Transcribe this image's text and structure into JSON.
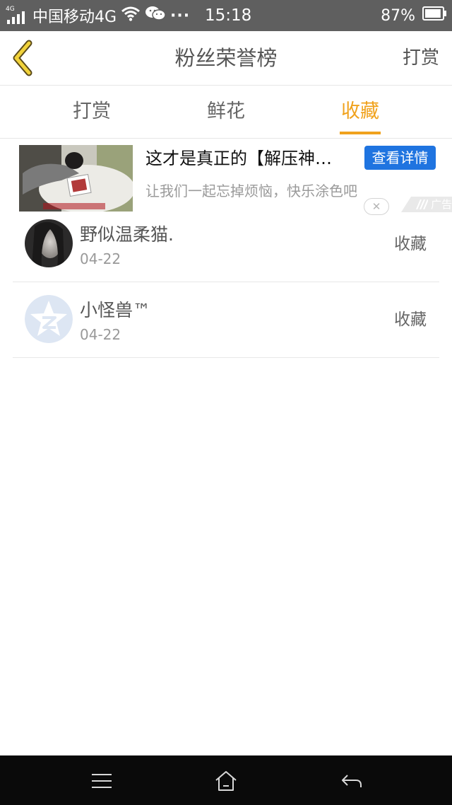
{
  "status_bar": {
    "network_type": "4G",
    "carrier": "中国移动4G",
    "more": "···",
    "time": "15:18",
    "battery": "87%",
    "battery_level": 0.87,
    "icons": [
      "signal-icon",
      "wifi-icon",
      "wechat-icon",
      "battery-icon"
    ]
  },
  "header": {
    "title": "粉丝荣誉榜",
    "action": "打赏",
    "back_icon": "chevron-left-icon"
  },
  "tabs": {
    "items": [
      {
        "label": "打赏"
      },
      {
        "label": "鲜花"
      },
      {
        "label": "收藏"
      }
    ],
    "active_index": 2,
    "active_color": "#f0a21d"
  },
  "ad": {
    "title": "这才是真正的【解压神…",
    "button": "查看详情",
    "description": "让我们一起忘掉烦恼，快乐涂色吧",
    "close_icon": "close-icon",
    "badge": "广告",
    "button_color": "#1f74e0"
  },
  "list": [
    {
      "name": "野似温柔猫.",
      "date": "04-22",
      "action": "收藏",
      "avatar": "photo-avatar"
    },
    {
      "name": "小怪兽™",
      "date": "04-22",
      "action": "收藏",
      "avatar": "qzone-default-avatar"
    }
  ],
  "nav": {
    "icons": [
      "menu-icon",
      "home-icon",
      "back-arrow-icon"
    ]
  }
}
